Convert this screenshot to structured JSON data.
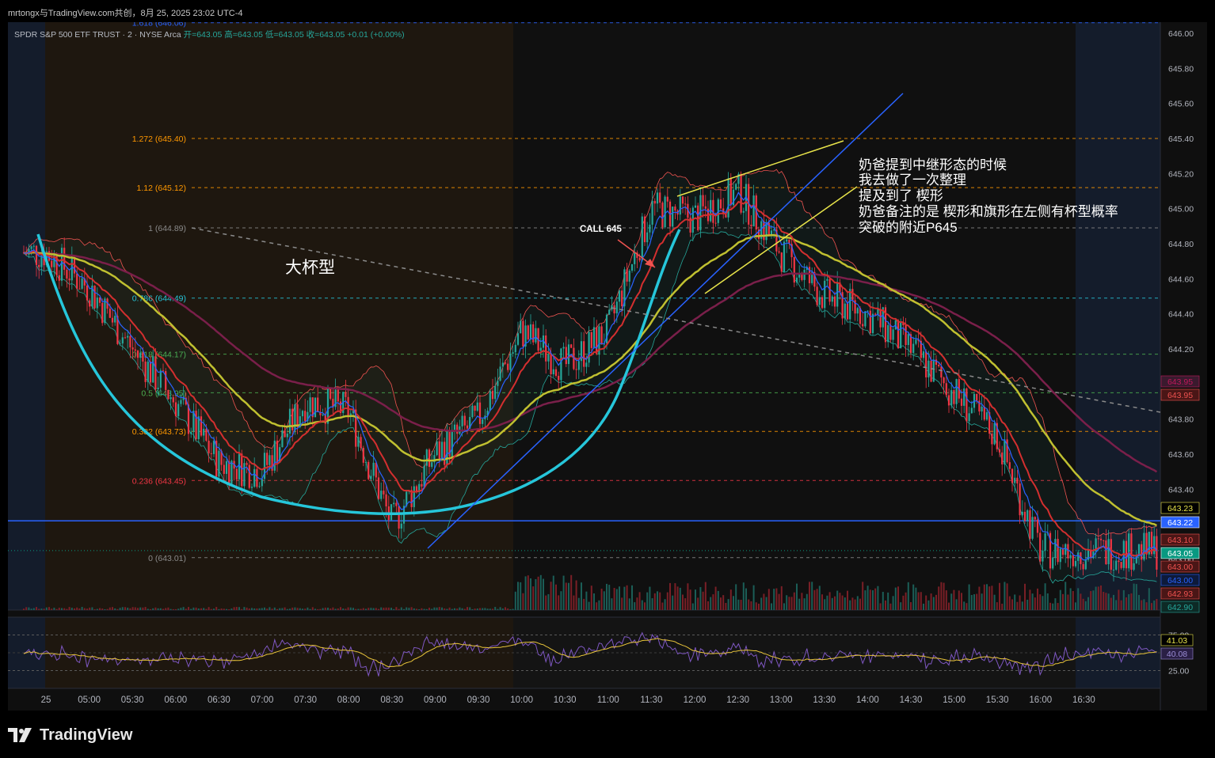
{
  "header": {
    "watermark": "mrtongx与TradingView.com共创，8月 25, 2025 23:02 UTC-4",
    "symbol": "SPDR S&P 500 ETF TRUST · 2 · NYSE Arca",
    "ohlc": "开=643.05 高=643.05 低=643.05 收=643.05 +0.01 (+0.00%)"
  },
  "footer": {
    "logo": "TradingView"
  },
  "annotations": {
    "cup": "大杯型",
    "call": "CALL 645",
    "notes": [
      "奶爸提到中继形态的时候",
      "我去做了一次整理",
      "提及到了 楔形",
      "奶爸备注的是 楔形和旗形在左侧有杯型概率",
      "突破的附近P645"
    ]
  },
  "chart_data": {
    "type": "candlestick",
    "title": "",
    "ylim": [
      642.85,
      646.08
    ],
    "y_ticks": [
      646.0,
      645.8,
      645.6,
      645.4,
      645.2,
      645.0,
      644.8,
      644.6,
      644.4,
      644.2,
      643.8,
      643.6,
      643.4,
      643.2,
      643.0
    ],
    "x_ticks": [
      "25",
      "05:00",
      "05:30",
      "06:00",
      "06:30",
      "07:00",
      "07:30",
      "08:00",
      "08:30",
      "09:00",
      "09:30",
      "10:00",
      "10:30",
      "11:00",
      "11:30",
      "12:00",
      "12:30",
      "13:00",
      "13:30",
      "14:00",
      "14:30",
      "15:00",
      "15:30",
      "16:00",
      "16:30"
    ],
    "fib_levels": [
      {
        "label": "1.618 (646.06)",
        "value": 646.06,
        "color": "#2962ff"
      },
      {
        "label": "1.272 (645.40)",
        "value": 645.4,
        "color": "#ff9800"
      },
      {
        "label": "1.12 (645.12)",
        "value": 645.12,
        "color": "#ff9800"
      },
      {
        "label": "1 (644.89)",
        "value": 644.89,
        "color": "#8a8a8a"
      },
      {
        "label": "0.786 (644.49)",
        "value": 644.49,
        "color": "#26c6da"
      },
      {
        "label": "0.618 (644.17)",
        "value": 644.17,
        "color": "#4caf50"
      },
      {
        "label": "0.5 (643.95)",
        "value": 643.95,
        "color": "#4caf50"
      },
      {
        "label": "0.382 (643.73)",
        "value": 643.73,
        "color": "#ff9800"
      },
      {
        "label": "0.236 (643.45)",
        "value": 643.45,
        "color": "#f23645"
      },
      {
        "label": "0 (643.01)",
        "value": 643.01,
        "color": "#8a8a8a"
      }
    ],
    "horizontal_line": {
      "value": 643.22,
      "color": "#2962ff"
    },
    "price_badges": [
      {
        "value": "643.95",
        "bg": "#3a1a2e",
        "fg": "#c2185b"
      },
      {
        "value": "643.95",
        "bg": "#4a1616",
        "fg": "#ef5350"
      },
      {
        "value": "643.23",
        "bg": "#000000",
        "fg": "#e8e44a"
      },
      {
        "value": "643.22",
        "bg": "#2962ff",
        "fg": "#ffffff"
      },
      {
        "value": "643.10",
        "bg": "#4a1616",
        "fg": "#ef5350"
      },
      {
        "value": "643.05",
        "bg": "#089981",
        "fg": "#ffffff"
      },
      {
        "value": "643.00",
        "bg": "#4a1616",
        "fg": "#ef5350"
      },
      {
        "value": "643.00",
        "bg": "#0d1a3a",
        "fg": "#2962ff"
      },
      {
        "value": "642.93",
        "bg": "#4a1616",
        "fg": "#ef5350"
      },
      {
        "value": "642.90",
        "bg": "#0d2a26",
        "fg": "#26a69a"
      }
    ],
    "rsi_ticks": [
      "75.00",
      "25.00"
    ],
    "rsi_badges": [
      {
        "value": "41.03",
        "bg": "#000000",
        "fg": "#e8e44a"
      },
      {
        "value": "40.08",
        "bg": "#2a1f45",
        "fg": "#9b8dd6"
      }
    ],
    "price_path": [
      [
        "25",
        644.75
      ],
      [
        "05:00",
        644.55
      ],
      [
        "05:30",
        644.2
      ],
      [
        "06:00",
        643.9
      ],
      [
        "06:30",
        643.55
      ],
      [
        "07:00",
        643.5
      ],
      [
        "07:30",
        643.9
      ],
      [
        "08:00",
        643.85
      ],
      [
        "08:30",
        643.2
      ],
      [
        "09:00",
        643.6
      ],
      [
        "09:30",
        643.8
      ],
      [
        "10:00",
        644.3
      ],
      [
        "10:30",
        644.1
      ],
      [
        "11:00",
        644.3
      ],
      [
        "11:30",
        645.0
      ],
      [
        "12:00",
        644.95
      ],
      [
        "12:30",
        645.1
      ],
      [
        "13:00",
        644.75
      ],
      [
        "13:30",
        644.5
      ],
      [
        "14:00",
        644.4
      ],
      [
        "14:30",
        644.2
      ],
      [
        "15:00",
        643.95
      ],
      [
        "15:30",
        643.7
      ],
      [
        "16:00",
        643.05
      ],
      [
        "16:30",
        643.05
      ]
    ]
  }
}
